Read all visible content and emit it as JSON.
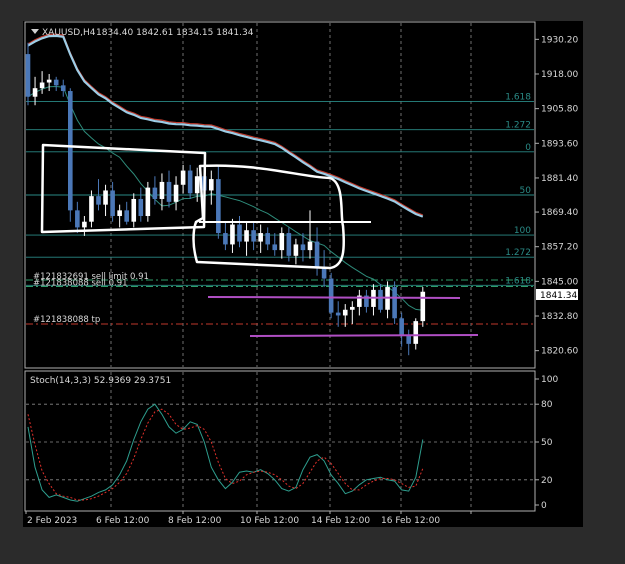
{
  "header": {
    "symbol": "XAUUSD,H4",
    "ohlc": "1834.40 1842.61 1834.15 1841.34"
  },
  "price_axis": {
    "ticks": [
      "1930.20",
      "1918.00",
      "1905.80",
      "1893.60",
      "1881.40",
      "1869.40",
      "1857.20",
      "1845.00",
      "1832.80",
      "1820.60"
    ],
    "current_price": "1841.34"
  },
  "fib_levels": [
    {
      "label": "1.618",
      "price": 1908.3
    },
    {
      "label": "1.272",
      "price": 1898.4
    },
    {
      "label": "0",
      "price": 1890.6
    },
    {
      "label": "50",
      "price": 1875.4
    },
    {
      "label": "100",
      "price": 1861.3
    },
    {
      "label": "1.272",
      "price": 1853.5
    },
    {
      "label": "1.618",
      "price": 1843.6
    }
  ],
  "order_lines": [
    {
      "label": "#121832691 sell limit 0.91",
      "price": 1845.5
    },
    {
      "label": "#121838088 sell 0.91",
      "price": 1843.2
    },
    {
      "label": "#121838088 tp",
      "price": 1830.0
    }
  ],
  "stochastic": {
    "title": "Stoch(14,3,3) 52.9369 29.3751",
    "ticks": [
      "100",
      "80",
      "50",
      "20",
      "0"
    ]
  },
  "time_axis": [
    "2 Feb 2023",
    "6 Feb 12:00",
    "8 Feb 12:00",
    "10 Feb 12:00",
    "14 Feb 12:00",
    "16 Feb 12:00"
  ],
  "colors": {
    "background": "#000000",
    "bull": "#ffffff",
    "bear": "#4b78b8",
    "ma_slow": "#9ecde6",
    "ma_slow_shadow": "#c0392b",
    "ma_mid": "#2e8b7a",
    "fib": "#2a8a86",
    "order_line": "#2e9e6a",
    "tp_line": "#c0392b",
    "hand_drawn": "#ffffff",
    "magenta": "#b04fc4",
    "stoch_main": "#2e9e8e",
    "stoch_signal": "#e0302a"
  },
  "chart_data": {
    "type": "candlestick",
    "title": "XAUUSD,H4",
    "x_start": "2 Feb 2023",
    "x_end": "16 Feb 2023",
    "ylim": [
      1814.5,
      1936.3
    ],
    "candles": [
      {
        "o": 1925,
        "h": 1929,
        "l": 1907,
        "c": 1910
      },
      {
        "o": 1910,
        "h": 1917,
        "l": 1907,
        "c": 1913
      },
      {
        "o": 1913,
        "h": 1919,
        "l": 1911,
        "c": 1915
      },
      {
        "o": 1915,
        "h": 1918,
        "l": 1912,
        "c": 1916
      },
      {
        "o": 1916,
        "h": 1917,
        "l": 1912,
        "c": 1914
      },
      {
        "o": 1914,
        "h": 1916,
        "l": 1910,
        "c": 1912
      },
      {
        "o": 1912,
        "h": 1913,
        "l": 1866,
        "c": 1870
      },
      {
        "o": 1870,
        "h": 1873,
        "l": 1862,
        "c": 1864
      },
      {
        "o": 1864,
        "h": 1868,
        "l": 1861,
        "c": 1866
      },
      {
        "o": 1866,
        "h": 1877,
        "l": 1864,
        "c": 1875
      },
      {
        "o": 1875,
        "h": 1881,
        "l": 1870,
        "c": 1872
      },
      {
        "o": 1872,
        "h": 1879,
        "l": 1868,
        "c": 1877
      },
      {
        "o": 1877,
        "h": 1880,
        "l": 1866,
        "c": 1868
      },
      {
        "o": 1868,
        "h": 1872,
        "l": 1864,
        "c": 1870
      },
      {
        "o": 1870,
        "h": 1873,
        "l": 1865,
        "c": 1866
      },
      {
        "o": 1866,
        "h": 1876,
        "l": 1864,
        "c": 1874
      },
      {
        "o": 1874,
        "h": 1878,
        "l": 1866,
        "c": 1868
      },
      {
        "o": 1868,
        "h": 1880,
        "l": 1866,
        "c": 1878
      },
      {
        "o": 1878,
        "h": 1882,
        "l": 1872,
        "c": 1874
      },
      {
        "o": 1874,
        "h": 1883,
        "l": 1870,
        "c": 1880
      },
      {
        "o": 1880,
        "h": 1884,
        "l": 1871,
        "c": 1873
      },
      {
        "o": 1873,
        "h": 1882,
        "l": 1870,
        "c": 1879
      },
      {
        "o": 1879,
        "h": 1886,
        "l": 1876,
        "c": 1884
      },
      {
        "o": 1884,
        "h": 1886,
        "l": 1874,
        "c": 1876
      },
      {
        "o": 1876,
        "h": 1885,
        "l": 1873,
        "c": 1882
      },
      {
        "o": 1882,
        "h": 1887,
        "l": 1875,
        "c": 1877
      },
      {
        "o": 1877,
        "h": 1884,
        "l": 1872,
        "c": 1881
      },
      {
        "o": 1881,
        "h": 1886,
        "l": 1860,
        "c": 1862
      },
      {
        "o": 1862,
        "h": 1866,
        "l": 1856,
        "c": 1858
      },
      {
        "o": 1858,
        "h": 1867,
        "l": 1855,
        "c": 1865
      },
      {
        "o": 1865,
        "h": 1868,
        "l": 1857,
        "c": 1859
      },
      {
        "o": 1859,
        "h": 1866,
        "l": 1854,
        "c": 1863
      },
      {
        "o": 1863,
        "h": 1866,
        "l": 1856,
        "c": 1859
      },
      {
        "o": 1859,
        "h": 1865,
        "l": 1855,
        "c": 1862
      },
      {
        "o": 1862,
        "h": 1864,
        "l": 1856,
        "c": 1858
      },
      {
        "o": 1858,
        "h": 1862,
        "l": 1854,
        "c": 1856
      },
      {
        "o": 1856,
        "h": 1864,
        "l": 1853,
        "c": 1862
      },
      {
        "o": 1862,
        "h": 1864,
        "l": 1852,
        "c": 1854
      },
      {
        "o": 1854,
        "h": 1860,
        "l": 1851,
        "c": 1858
      },
      {
        "o": 1858,
        "h": 1862,
        "l": 1852,
        "c": 1856
      },
      {
        "o": 1856,
        "h": 1870,
        "l": 1853,
        "c": 1859
      },
      {
        "o": 1859,
        "h": 1864,
        "l": 1847,
        "c": 1850
      },
      {
        "o": 1850,
        "h": 1856,
        "l": 1843,
        "c": 1846
      },
      {
        "o": 1846,
        "h": 1848,
        "l": 1832,
        "c": 1834
      },
      {
        "o": 1834,
        "h": 1838,
        "l": 1829,
        "c": 1833
      },
      {
        "o": 1833,
        "h": 1837,
        "l": 1829,
        "c": 1835
      },
      {
        "o": 1835,
        "h": 1838,
        "l": 1830,
        "c": 1836
      },
      {
        "o": 1836,
        "h": 1842,
        "l": 1833,
        "c": 1840
      },
      {
        "o": 1840,
        "h": 1842,
        "l": 1834,
        "c": 1836
      },
      {
        "o": 1836,
        "h": 1844,
        "l": 1833,
        "c": 1842
      },
      {
        "o": 1842,
        "h": 1844,
        "l": 1834,
        "c": 1835
      },
      {
        "o": 1835,
        "h": 1845,
        "l": 1832,
        "c": 1843
      },
      {
        "o": 1843,
        "h": 1845,
        "l": 1830,
        "c": 1832
      },
      {
        "o": 1832,
        "h": 1834,
        "l": 1822,
        "c": 1826
      },
      {
        "o": 1826,
        "h": 1828,
        "l": 1819,
        "c": 1823
      },
      {
        "o": 1823,
        "h": 1832,
        "l": 1821,
        "c": 1831
      },
      {
        "o": 1831,
        "h": 1843,
        "l": 1829,
        "c": 1841.34
      }
    ],
    "stoch_k": [
      62,
      30,
      12,
      6,
      8,
      6,
      4,
      3,
      5,
      7,
      10,
      12,
      16,
      24,
      35,
      52,
      66,
      76,
      80,
      72,
      62,
      57,
      60,
      66,
      64,
      50,
      30,
      20,
      13,
      18,
      26,
      27,
      26,
      28,
      25,
      20,
      13,
      11,
      14,
      28,
      38,
      40,
      35,
      24,
      17,
      9,
      11,
      16,
      20,
      21,
      22,
      20,
      19,
      12,
      11,
      22,
      52
    ],
    "stoch_d": [
      72,
      48,
      27,
      17,
      9,
      7,
      6,
      4,
      4,
      5,
      7,
      10,
      13,
      18,
      25,
      37,
      52,
      65,
      74,
      76,
      72,
      64,
      60,
      61,
      63,
      60,
      50,
      34,
      21,
      17,
      19,
      24,
      26,
      27,
      26,
      24,
      20,
      15,
      13,
      17,
      26,
      35,
      38,
      33,
      25,
      17,
      12,
      12,
      16,
      19,
      21,
      21,
      20,
      17,
      14,
      15,
      29
    ]
  }
}
